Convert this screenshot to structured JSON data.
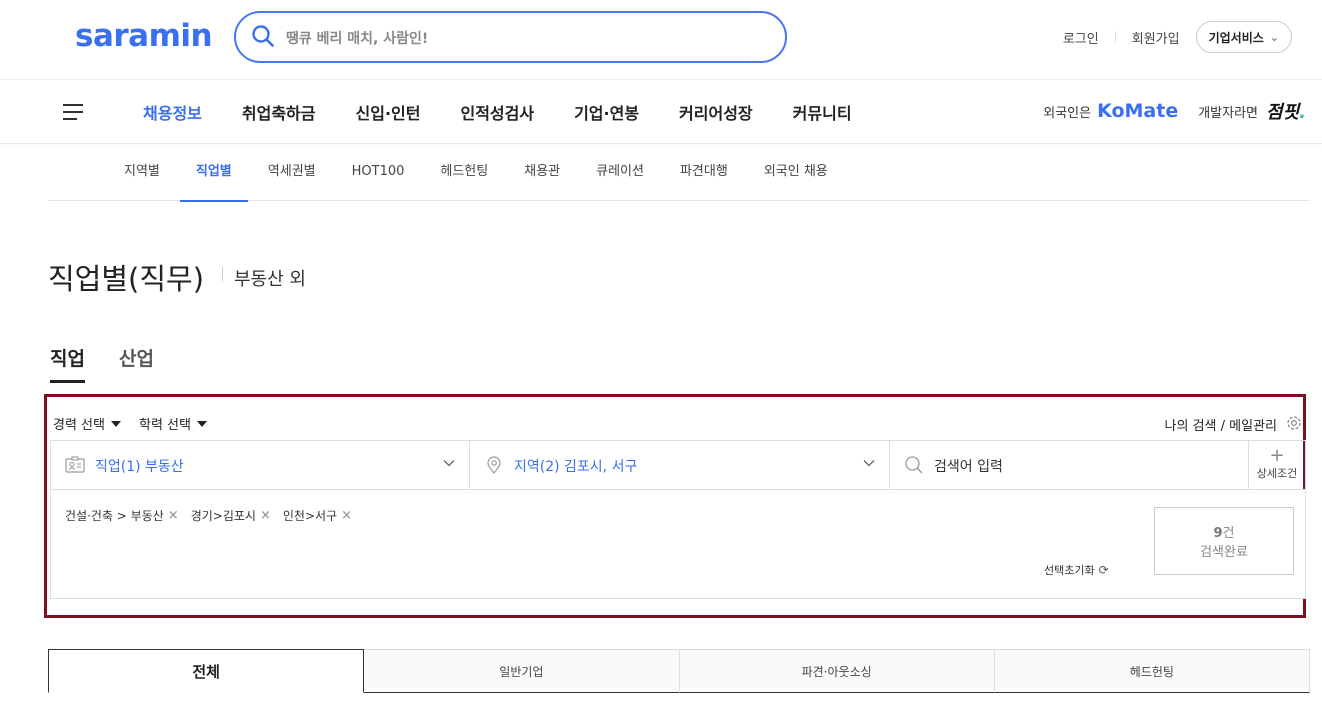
{
  "header": {
    "logo": "saramin",
    "search_placeholder": "땡큐 베리 매치, 사람인!",
    "login": "로그인",
    "signup": "회원가입",
    "corp_service": "기업서비스"
  },
  "nav": {
    "items": [
      "채용정보",
      "취업축하금",
      "신입·인턴",
      "인적성검사",
      "기업·연봉",
      "커리어성장",
      "커뮤니티"
    ],
    "foreigner_label": "외국인은",
    "komate": "KoMate",
    "developer_label": "개발자라면",
    "jeompit": "점핏"
  },
  "subnav": {
    "items": [
      "지역별",
      "직업별",
      "역세권별",
      "HOT100",
      "헤드헌팅",
      "채용관",
      "큐레이션",
      "파견대행",
      "외국인 채용"
    ]
  },
  "page": {
    "title": "직업별(직무)",
    "subtitle": "부동산 외"
  },
  "tabs": [
    "직업",
    "산업"
  ],
  "filters": {
    "career": "경력 선택",
    "education": "학력 선택",
    "my_search": "나의 검색 / 메일관리",
    "job": "직업(1) 부동산",
    "region": "지역(2) 김포시, 서구",
    "keyword_placeholder": "검색어 입력",
    "detail": "상세조건",
    "chips": [
      "건설·건축 > 부동산",
      "경기>김포시",
      "인천>서구"
    ],
    "reset": "선택초기화",
    "result_count": "9",
    "result_unit": "건",
    "result_label": "검색완료"
  },
  "bottom_tabs": [
    "전체",
    "일반기업",
    "파견·아웃소싱",
    "헤드헌팅"
  ],
  "colors": {
    "brand": "#3a6ff2",
    "highlight_border": "#7d0f22"
  }
}
